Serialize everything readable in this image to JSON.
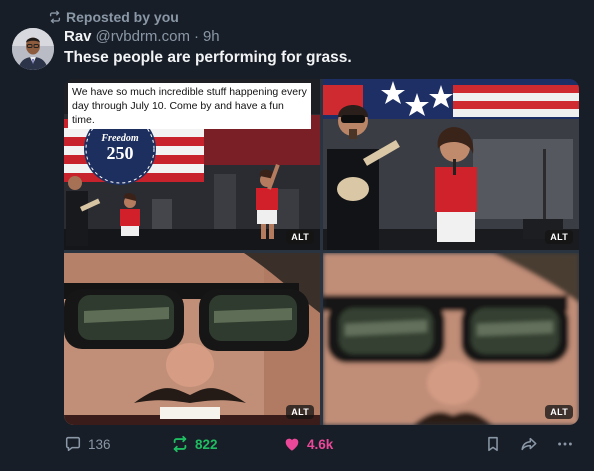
{
  "post": {
    "repost_label": "Reposted by you",
    "author_name": "Rav",
    "author_handle": "@rvbdrm.com",
    "separator": "·",
    "time": "9h",
    "text": "These people are performing for grass.",
    "images": [
      {
        "caption": "We have so much incredible stuff happening every day through July 10. Come by and have a fun time.",
        "banner_word": "Freedom",
        "banner_number": "250",
        "alt_label": "ALT"
      },
      {
        "alt_label": "ALT"
      },
      {
        "alt_label": "ALT"
      },
      {
        "alt_label": "ALT"
      }
    ],
    "actions": {
      "reply_count": "136",
      "repost_count": "822",
      "like_count": "4.6k"
    }
  },
  "colors": {
    "background": "#171e27",
    "repost_active": "#20bc62",
    "like_active": "#ec4899",
    "muted": "#8a97a6"
  }
}
